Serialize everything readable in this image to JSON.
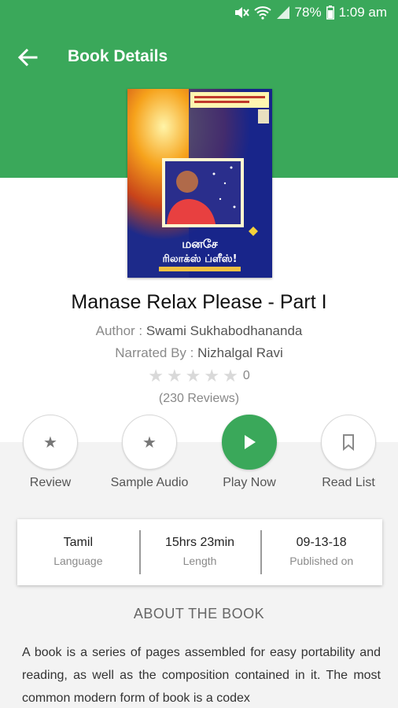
{
  "status_bar": {
    "battery": "78%",
    "time": "1:09 am"
  },
  "header": {
    "title": "Book Details"
  },
  "book": {
    "cover_title_text": "மனசே ரிலாக்ஸ் ப்ளீஸ்!",
    "title": "Manase Relax Please - Part I",
    "author_label": "Author : ",
    "author": "Swami Sukhabodhananda",
    "narrator_label": "Narrated By : ",
    "narrator": "Nizhalgal Ravi",
    "rating_value": 0,
    "rating_max": 5,
    "rating_text": "0",
    "reviews": "(230 Reviews)"
  },
  "actions": [
    {
      "label": "Review",
      "icon": "star-icon"
    },
    {
      "label": "Sample Audio",
      "icon": "star-icon"
    },
    {
      "label": "Play Now",
      "icon": "play-icon"
    },
    {
      "label": "Read List",
      "icon": "bookmark-icon"
    }
  ],
  "info": {
    "language_value": "Tamil",
    "language_label": "Language",
    "length_value": "15hrs 23min",
    "length_label": "Length",
    "published_value": "09-13-18",
    "published_label": "Published on"
  },
  "about": {
    "heading": "ABOUT THE BOOK",
    "text": "A book is a series of pages assembled for easy portability and reading, as well as the composition contained in it. The most common modern form of book is a codex"
  },
  "colors": {
    "primary": "#3aa85a",
    "background": "#f3f3f3"
  }
}
